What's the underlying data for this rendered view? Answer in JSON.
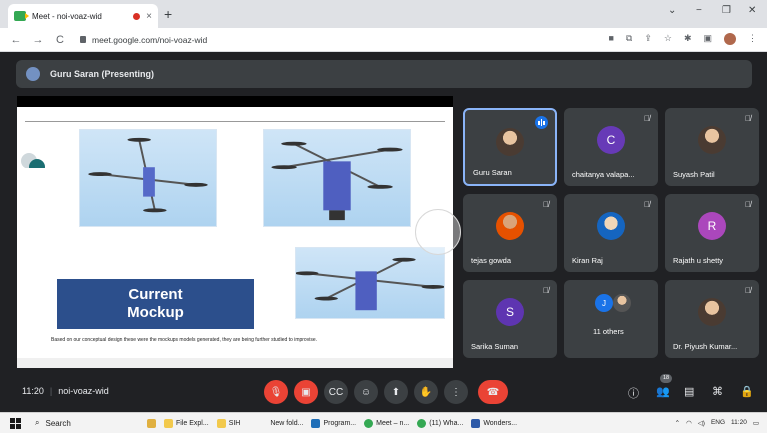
{
  "browser": {
    "tab_title": "Meet - noi-voaz-wid",
    "tab_close": "×",
    "new_tab": "+",
    "url": "meet.google.com/noi-voaz-wid",
    "window_controls": [
      "⌄",
      "−",
      "❐",
      "✕"
    ]
  },
  "meet": {
    "presenting_label": "Guru Saran (Presenting)",
    "slide": {
      "title_line1": "Current",
      "title_line2": "Mockup",
      "caption": "Based on our conceptual design these were the mockups models generated, they are being further studied to improvise."
    },
    "participants": [
      {
        "name": "Guru Saran",
        "initial": "",
        "color": "#5f6368",
        "speaking": true,
        "muted": false
      },
      {
        "name": "chaitanya valapa...",
        "initial": "C",
        "color": "#673ab7",
        "speaking": false,
        "muted": true
      },
      {
        "name": "Suyash Patil",
        "initial": "",
        "color": "#8d6e63",
        "speaking": false,
        "muted": true
      },
      {
        "name": "tejas gowda",
        "initial": "",
        "color": "#e65100",
        "speaking": false,
        "muted": true
      },
      {
        "name": "Kiran Raj",
        "initial": "",
        "color": "#1565c0",
        "speaking": false,
        "muted": true
      },
      {
        "name": "Rajath u shetty",
        "initial": "R",
        "color": "#ab47bc",
        "speaking": false,
        "muted": true
      },
      {
        "name": "Sarika Suman",
        "initial": "S",
        "color": "#5e35b1",
        "speaking": false,
        "muted": true
      },
      {
        "name": "11 others",
        "initial": "J",
        "color": "#1a73e8",
        "speaking": false,
        "muted": false
      },
      {
        "name": "Dr. Piyush Kumar...",
        "initial": "",
        "color": "#795548",
        "speaking": false,
        "muted": true
      }
    ],
    "time": "11:20",
    "meeting_code": "noi-voaz-wid",
    "participant_count": "18"
  },
  "taskbar": {
    "search_label": "Search",
    "items": [
      "File Expl...",
      "SIH",
      "New fold...",
      "Program...",
      "Meet – n...",
      "(11) Wha...",
      "Wonders..."
    ],
    "language": "ENG",
    "clock": "11:20"
  }
}
